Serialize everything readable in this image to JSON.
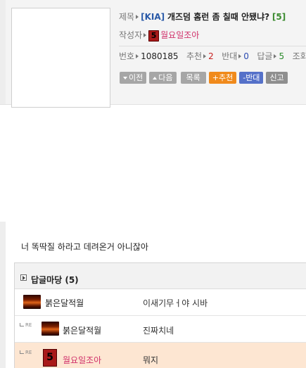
{
  "post": {
    "subject_label": "제목",
    "category": "[KIA]",
    "title": "개즈덤 홈런 좀 칠때 안됐냐?",
    "reply_count": "[5]",
    "author_label": "작성자",
    "author_level": "5",
    "author": "월요일조아",
    "meta": {
      "no_label": "번호",
      "no_value": "1080185",
      "rec_label": "추천",
      "rec_value": "2",
      "opp_label": "반대",
      "opp_value": "0",
      "reply_label": "답글",
      "reply_value": "5",
      "views_label": "조회"
    },
    "body": "너 똑딱질 하라고 데려온거 아니잖아"
  },
  "buttons": {
    "prev": "이전",
    "next": "다음",
    "list": "목록",
    "recommend": "+추천",
    "oppose": "-반대",
    "report": "신고"
  },
  "replies": {
    "title": "답글마당 (5)",
    "re_label": "RE",
    "items": [
      {
        "name": "붉은달적월",
        "text": "이새기무ㅓ야 시바",
        "is_reply": false
      },
      {
        "name": "붉은달적월",
        "text": "진짜치네",
        "is_reply": true
      },
      {
        "name": "월요일조아",
        "text": "뭐지",
        "is_reply": true,
        "level": "5"
      }
    ]
  },
  "colors": {
    "category": "#2a5aa8",
    "author": "#d0306a",
    "recommend_btn": "#f08a1c",
    "oppose_btn": "#5571c9",
    "highlight_row": "#fde6d2"
  }
}
